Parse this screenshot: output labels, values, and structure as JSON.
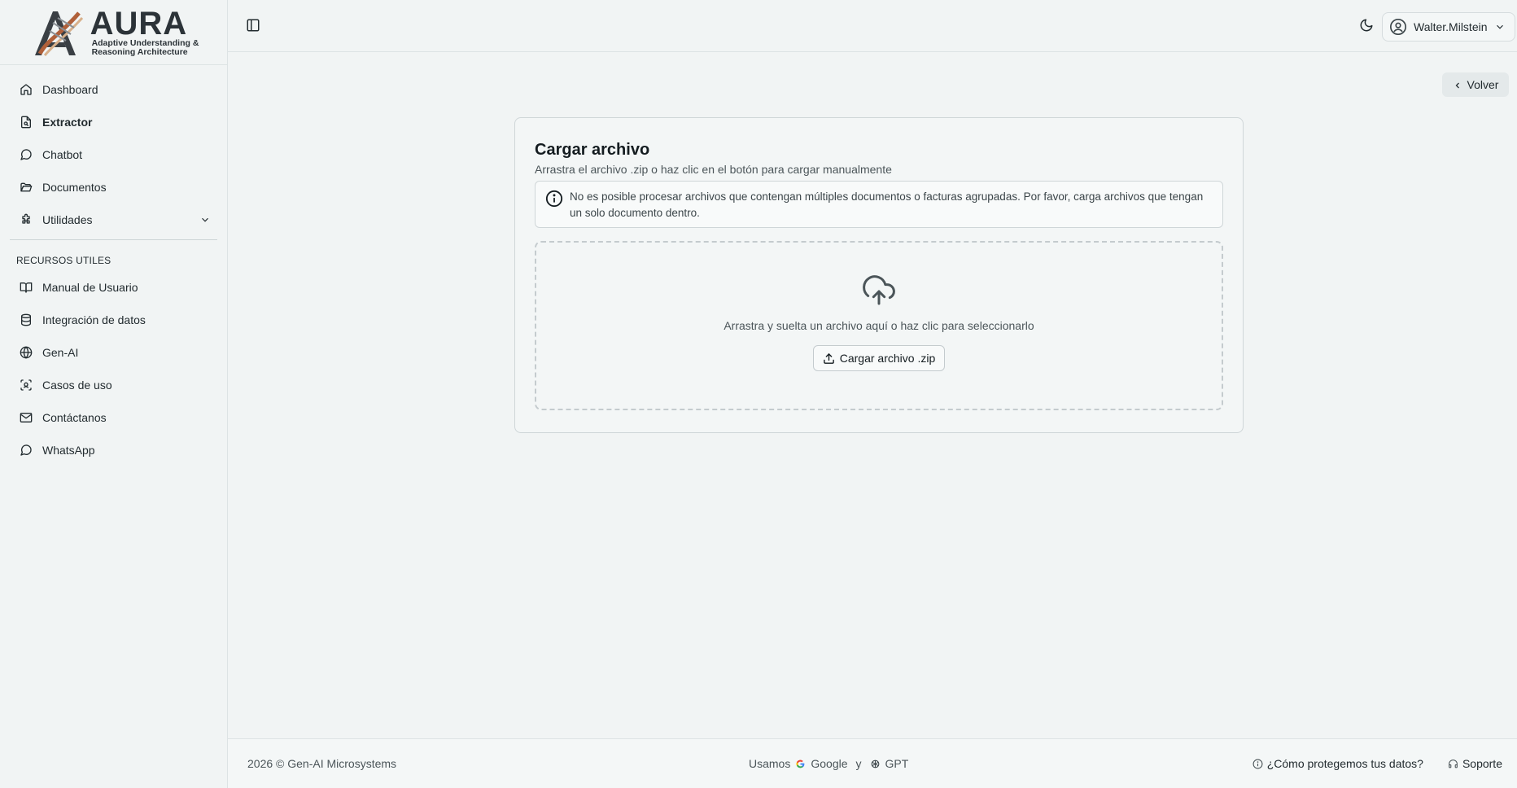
{
  "brand": {
    "name": "AURA",
    "tagline_line1": "Adaptive Understanding &",
    "tagline_line2": "Reasoning Architecture"
  },
  "sidebar": {
    "items": [
      {
        "label": "Dashboard",
        "icon": "home-icon"
      },
      {
        "label": "Extractor",
        "icon": "file-search-icon",
        "active": true
      },
      {
        "label": "Chatbot",
        "icon": "chat-bubble-icon"
      },
      {
        "label": "Documentos",
        "icon": "folder-open-icon"
      },
      {
        "label": "Utilidades",
        "icon": "puzzle-icon",
        "expandable": true
      }
    ],
    "section_title": "RECURSOS UTILES",
    "resources": [
      {
        "label": "Manual de Usuario",
        "icon": "book-open-icon"
      },
      {
        "label": "Integración de datos",
        "icon": "database-icon"
      },
      {
        "label": "Gen-AI",
        "icon": "globe-icon"
      },
      {
        "label": "Casos de uso",
        "icon": "scan-face-icon"
      },
      {
        "label": "Contáctanos",
        "icon": "mail-icon"
      },
      {
        "label": "WhatsApp",
        "icon": "chat-bubble-icon"
      }
    ]
  },
  "header": {
    "user_name": "Walter.Milstein"
  },
  "main": {
    "back_label": "Volver",
    "card": {
      "title": "Cargar archivo",
      "subtitle": "Arrastra el archivo .zip o haz clic en el botón para cargar manualmente",
      "alert_text": "No es posible procesar archivos que contengan múltiples documentos o facturas agrupadas. Por favor, carga archivos que tengan un solo documento dentro.",
      "dropzone_text": "Arrastra y suelta un archivo aquí o haz clic para seleccionarlo",
      "upload_button": "Cargar archivo .zip"
    }
  },
  "footer": {
    "copyright": "2026 © Gen-AI Microsystems",
    "uses_label": "Usamos",
    "provider1": "Google",
    "and_label": "y",
    "provider2": "GPT",
    "privacy_link": "¿Cómo protegemos tus datos?",
    "support_link": "Soporte"
  },
  "colors": {
    "background": "#f1f4f4",
    "border": "#dde3e4",
    "text": "#1f2a2e"
  }
}
